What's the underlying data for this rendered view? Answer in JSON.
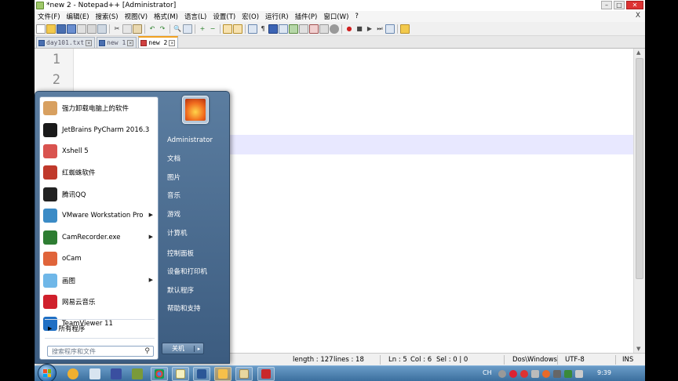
{
  "window": {
    "title": "*new 2 - Notepad++ [Administrator]"
  },
  "menubar": {
    "items": [
      "文件(F)",
      "编辑(E)",
      "搜索(S)",
      "视图(V)",
      "格式(M)",
      "语言(L)",
      "设置(T)",
      "宏(O)",
      "运行(R)",
      "插件(P)",
      "窗口(W)",
      "?"
    ],
    "close_glyph": "X"
  },
  "tabs": [
    {
      "label": "day101.txt"
    },
    {
      "label": "new 1"
    },
    {
      "label": "new 2"
    }
  ],
  "editor": {
    "line_numbers": [
      "1",
      "2"
    ]
  },
  "statusbar": {
    "length": "length : 127",
    "lines": "lines : 18",
    "ln": "Ln : 5",
    "col": "Col : 6",
    "sel": "Sel : 0 | 0",
    "eol": "Dos\\Windows",
    "encoding": "UTF-8",
    "mode": "INS"
  },
  "start_menu": {
    "programs": [
      {
        "label": "强力卸载电脑上的软件",
        "icon": "uninstaller-icon",
        "color": "#d8a060",
        "submenu": false
      },
      {
        "label": "JetBrains PyCharm 2016.3",
        "icon": "pycharm-icon",
        "color": "#1a1a1a",
        "submenu": false
      },
      {
        "label": "Xshell 5",
        "icon": "xshell-icon",
        "color": "#d9534f",
        "submenu": false
      },
      {
        "label": "红蜘蛛软件",
        "icon": "red-spider-icon",
        "color": "#c0392b",
        "submenu": false
      },
      {
        "label": "腾讯QQ",
        "icon": "qq-icon",
        "color": "#222222",
        "submenu": false
      },
      {
        "label": "VMware Workstation Pro",
        "icon": "vmware-icon",
        "color": "#3b8bc6",
        "submenu": true
      },
      {
        "label": "CamRecorder.exe",
        "icon": "camrecorder-icon",
        "color": "#2e7d32",
        "submenu": true
      },
      {
        "label": "oCam",
        "icon": "ocam-icon",
        "color": "#e0643a",
        "submenu": false
      },
      {
        "label": "画图",
        "icon": "paint-icon",
        "color": "#6fb7e8",
        "submenu": true
      },
      {
        "label": "网易云音乐",
        "icon": "netease-music-icon",
        "color": "#d0202c",
        "submenu": false
      },
      {
        "label": "TeamViewer 11",
        "icon": "teamviewer-icon",
        "color": "#1f6fc4",
        "submenu": false
      }
    ],
    "all_programs": "所有程序",
    "search_placeholder": "搜索程序和文件",
    "right_items": [
      "Administrator",
      "文档",
      "图片",
      "音乐",
      "游戏",
      "计算机",
      "控制面板",
      "设备和打印机",
      "默认程序",
      "帮助和支持"
    ],
    "shutdown_label": "关机"
  },
  "taskbar": {
    "clock": "9:39",
    "lang": "CH"
  }
}
